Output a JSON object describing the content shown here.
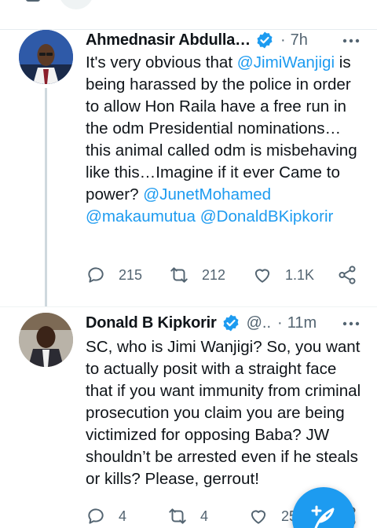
{
  "colors": {
    "accent": "#1d9bf0",
    "text": "#0f1419",
    "secondary": "#536471"
  },
  "tweets": [
    {
      "name": "Ahmednasir Abdulla…",
      "handle": "",
      "dot": "·",
      "time": "7h",
      "verified": true,
      "text_parts": [
        {
          "t": "It's very obvious that ",
          "mention": false
        },
        {
          "t": "@JimiWanjigi",
          "mention": true
        },
        {
          "t": " is being harassed by the police in order to allow Hon Raila have a free run in the odm Presidential nominations…this animal called odm is misbehaving like this…Imagine if it ever Came to power? ",
          "mention": false
        },
        {
          "t": "@JunetMohamed",
          "mention": true
        },
        {
          "t": " ",
          "mention": false
        },
        {
          "t": "@makaumutua",
          "mention": true
        },
        {
          "t": " ",
          "mention": false
        },
        {
          "t": "@DonaldBKipkorir",
          "mention": true
        }
      ],
      "replies": "215",
      "retweets": "212",
      "likes": "1.1K"
    },
    {
      "name": "Donald B Kipkorir",
      "handle": "@..",
      "dot": "·",
      "time": "11m",
      "verified": true,
      "text_parts": [
        {
          "t": "SC, who is Jimi Wanjigi? So, you want to actually posit with a straight face that if you want immunity from criminal prosecution you claim you are being victimized for opposing Baba? JW shouldn’t be arrested even if he steals or kills? Please, gerrout!",
          "mention": false
        }
      ],
      "replies": "4",
      "retweets": "4",
      "likes": "25"
    }
  ],
  "icons": {
    "verified": "verified-badge-icon",
    "more": "more-dots-icon",
    "reply": "reply-icon",
    "retweet": "retweet-icon",
    "like": "heart-icon",
    "share": "share-icon",
    "compose": "compose-feather-icon"
  }
}
